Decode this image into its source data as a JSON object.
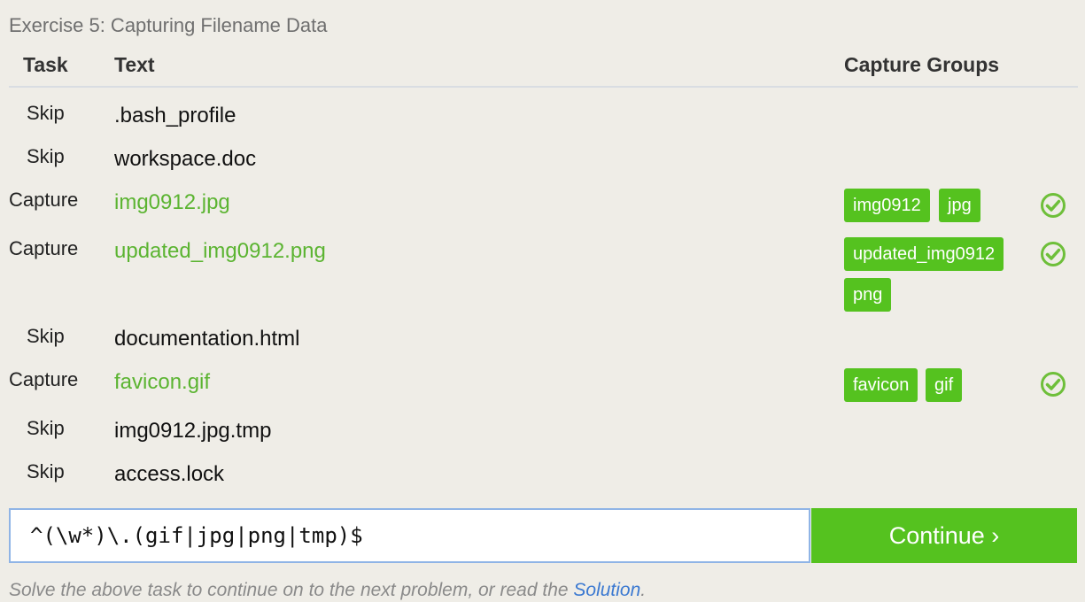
{
  "title": "Exercise 5: Capturing Filename Data",
  "headers": {
    "task": "Task",
    "text": "Text",
    "groups": "Capture Groups"
  },
  "rows": [
    {
      "task": "Skip",
      "text": ".bash_profile",
      "groups": []
    },
    {
      "task": "Skip",
      "text": "workspace.doc",
      "groups": []
    },
    {
      "task": "Capture",
      "text": "img0912.jpg",
      "groups": [
        "img0912",
        "jpg"
      ],
      "status": "check-icon"
    },
    {
      "task": "Capture",
      "text": "updated_img0912.png",
      "groups": [
        "updated_img0912",
        "png"
      ],
      "status": "check-icon"
    },
    {
      "task": "Skip",
      "text": "documentation.html",
      "groups": []
    },
    {
      "task": "Capture",
      "text": "favicon.gif",
      "groups": [
        "favicon",
        "gif"
      ],
      "status": "check-icon"
    },
    {
      "task": "Skip",
      "text": "img0912.jpg.tmp",
      "groups": []
    },
    {
      "task": "Skip",
      "text": "access.lock",
      "groups": []
    }
  ],
  "input": {
    "value": "^(\\w*)\\.(gif|jpg|png|tmp)$"
  },
  "continue_label": "Continue ›",
  "footer": {
    "prefix": "Solve the above task to continue on to the next problem, or read the ",
    "link": "Solution",
    "suffix": "."
  },
  "colors": {
    "accent": "#55c21f",
    "link": "#3b79d1",
    "background": "#efede7"
  }
}
